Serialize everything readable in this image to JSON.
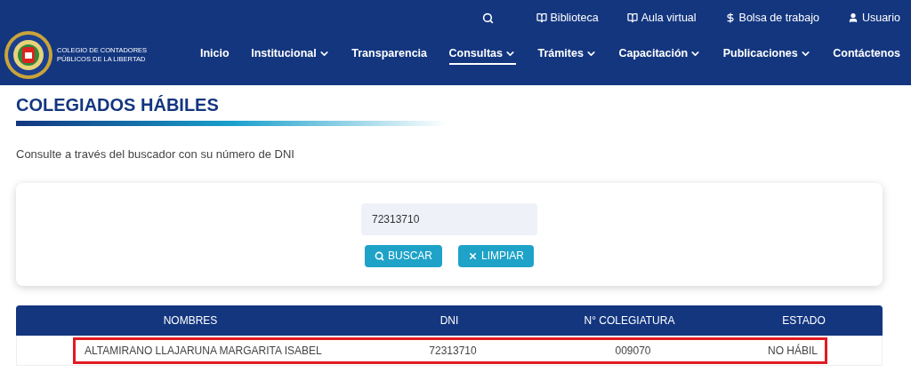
{
  "top_links": [
    {
      "kind": "search"
    },
    {
      "kind": "book",
      "label": "Biblioteca"
    },
    {
      "kind": "book",
      "label": "Aula virtual"
    },
    {
      "kind": "money",
      "label": "Bolsa de trabajo"
    },
    {
      "kind": "user",
      "label": "Usuario"
    }
  ],
  "logo": {
    "lines": [
      "COLEGIO DE CONTADORES",
      "PÚBLICOS DE LA LIBERTAD"
    ]
  },
  "nav": [
    {
      "label": "Inicio",
      "dropdown": false,
      "selected": false
    },
    {
      "label": "Institucional",
      "dropdown": true,
      "selected": false
    },
    {
      "label": "Transparencia",
      "dropdown": false,
      "selected": false
    },
    {
      "label": "Consultas",
      "dropdown": true,
      "selected": true
    },
    {
      "label": "Trámites",
      "dropdown": true,
      "selected": false
    },
    {
      "label": "Capacitación",
      "dropdown": true,
      "selected": false
    },
    {
      "label": "Publicaciones",
      "dropdown": true,
      "selected": false
    },
    {
      "label": "Contáctenos",
      "dropdown": false,
      "selected": false
    }
  ],
  "page_title": "COLEGIADOS HÁBILES",
  "intro": "Consulte a través del buscador con su número de DNI",
  "search": {
    "value": "72313710",
    "buttons": [
      {
        "kind": "search",
        "label": "BUSCAR"
      },
      {
        "kind": "clear",
        "label": "LIMPIAR"
      }
    ]
  },
  "table": {
    "columns": [
      "NOMBRES",
      "DNI",
      "N° COLEGIATURA",
      "ESTADO"
    ],
    "rows": [
      {
        "highlighted": true,
        "cells": [
          "ALTAMIRANO LLAJARUNA MARGARITA ISABEL",
          "72313710",
          "009070",
          "NO HÁBIL"
        ]
      }
    ]
  }
}
